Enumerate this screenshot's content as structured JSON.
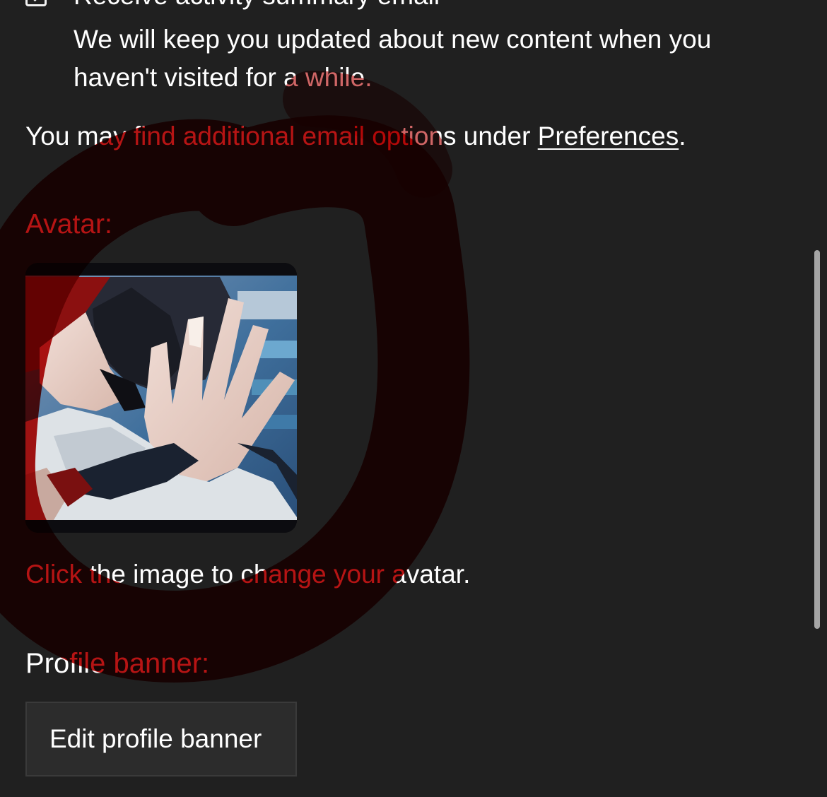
{
  "email_settings": {
    "checkbox_label": "Receive activity summary email",
    "checkbox_checked": true,
    "checkbox_description": "We will keep you updated about new content when you haven't visited for a while.",
    "more_options_prefix": "You may find additional email options under ",
    "preferences_link": "Preferences",
    "more_options_suffix": "."
  },
  "avatar": {
    "heading": "Avatar:",
    "help_text": "Click the image to change your avatar."
  },
  "banner": {
    "heading": "Profile banner:",
    "edit_button": "Edit profile banner"
  },
  "colors": {
    "background": "#202020",
    "text": "#ffffff",
    "red_annotation": "#b00000",
    "button_background": "#2c2c2c"
  }
}
